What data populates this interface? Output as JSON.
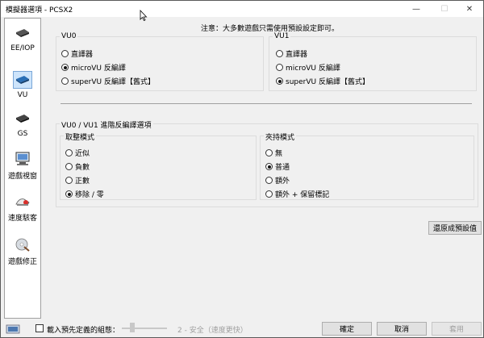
{
  "window": {
    "title": "模擬器選項 - PCSX2",
    "controls": {
      "minimize": "—",
      "maximize": "☐",
      "close": "✕"
    }
  },
  "sidebar": {
    "items": [
      {
        "label": "EE/IOP",
        "icon": "chip-icon",
        "selected": false
      },
      {
        "label": "VU",
        "icon": "vu-chip-icon",
        "selected": true
      },
      {
        "label": "GS",
        "icon": "gs-chip-icon",
        "selected": false
      },
      {
        "label": "遊戲視窗",
        "icon": "monitor-icon",
        "selected": false
      },
      {
        "label": "速度駭客",
        "icon": "speed-hack-icon",
        "selected": false
      },
      {
        "label": "遊戲修正",
        "icon": "game-fix-icon",
        "selected": false
      }
    ]
  },
  "notice": "注意：大多數遊戲只需使用預設設定即可。",
  "vu0": {
    "title": "VU0",
    "options": [
      {
        "label": "直譯器",
        "selected": false
      },
      {
        "label": "microVU 反編譯",
        "selected": true
      },
      {
        "label": "superVU 反編譯【舊式】",
        "selected": false
      }
    ]
  },
  "vu1": {
    "title": "VU1",
    "options": [
      {
        "label": "直譯器",
        "selected": false
      },
      {
        "label": "microVU 反編譯",
        "selected": false
      },
      {
        "label": "superVU 反編譯【舊式】",
        "selected": true
      }
    ]
  },
  "advanced": {
    "title": "VU0 / VU1 進階反編譯選項",
    "rounding": {
      "title": "取整模式",
      "options": [
        {
          "label": "近似",
          "selected": false
        },
        {
          "label": "負數",
          "selected": false
        },
        {
          "label": "正數",
          "selected": false
        },
        {
          "label": "移除 / 零",
          "selected": true
        }
      ]
    },
    "clamping": {
      "title": "夾持模式",
      "options": [
        {
          "label": "無",
          "selected": false
        },
        {
          "label": "普通",
          "selected": true
        },
        {
          "label": "額外",
          "selected": false
        },
        {
          "label": "額外 + 保留標記",
          "selected": false
        }
      ]
    }
  },
  "restore_defaults": "還原成預設值",
  "footer": {
    "preset_checkbox_label": "載入預先定義的組態：",
    "preset_value": "2 - 安全（速度更快）",
    "ok": "確定",
    "cancel": "取消",
    "apply": "套用"
  }
}
